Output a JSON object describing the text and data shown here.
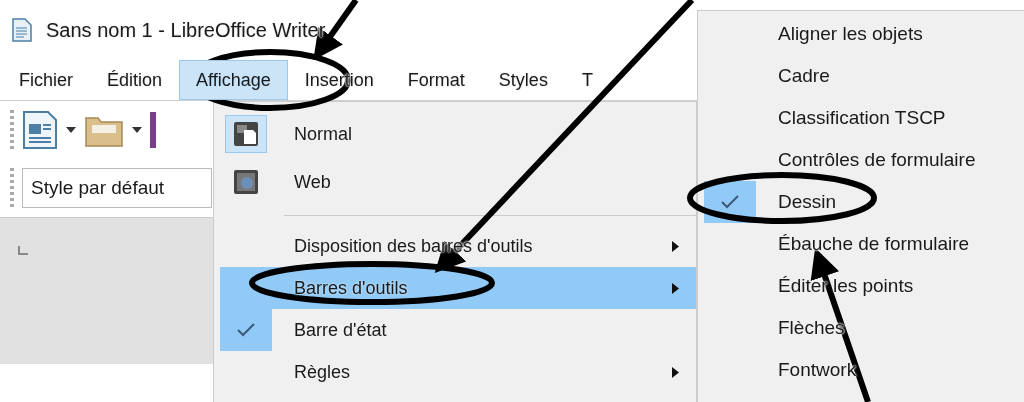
{
  "window": {
    "title": "Sans nom 1 - LibreOffice Writer"
  },
  "menubar": [
    {
      "label": "Fichier",
      "selected": false
    },
    {
      "label": "Édition",
      "selected": false
    },
    {
      "label": "Affichage",
      "selected": true
    },
    {
      "label": "Insertion",
      "selected": false
    },
    {
      "label": "Format",
      "selected": false
    },
    {
      "label": "Styles",
      "selected": false
    },
    {
      "label": "T",
      "selected": false
    }
  ],
  "toolbar": {
    "paragraph_style": "Style par défaut"
  },
  "view_menu": [
    {
      "kind": "icon",
      "label": "Normal",
      "checked": true,
      "selected": false,
      "submenu": false
    },
    {
      "kind": "icon",
      "label": "Web",
      "checked": false,
      "selected": false,
      "submenu": false
    },
    {
      "kind": "separator"
    },
    {
      "kind": "item",
      "label": "Disposition des barres d'outils",
      "checked": false,
      "selected": false,
      "submenu": true
    },
    {
      "kind": "item",
      "label": "Barres d'outils",
      "checked": false,
      "selected": true,
      "submenu": true
    },
    {
      "kind": "item",
      "label": "Barre d'état",
      "checked": true,
      "selected": false,
      "submenu": false
    },
    {
      "kind": "item",
      "label": "Règles",
      "checked": false,
      "selected": false,
      "submenu": true
    }
  ],
  "toolbars_submenu": [
    {
      "label": "Aligner les objets",
      "checked": false
    },
    {
      "label": "Cadre",
      "checked": false
    },
    {
      "label": "Classification TSCP",
      "checked": false
    },
    {
      "label": "Contrôles de formulaire",
      "checked": false
    },
    {
      "label": "Dessin",
      "checked": true
    },
    {
      "label": "Ébauche de formulaire",
      "checked": false
    },
    {
      "label": "Éditer les points",
      "checked": false
    },
    {
      "label": "Flèches",
      "checked": false
    },
    {
      "label": "Fontwork",
      "checked": false
    }
  ],
  "annotations": [
    {
      "kind": "ellipse"
    },
    {
      "kind": "ellipse"
    },
    {
      "kind": "ellipse"
    },
    {
      "kind": "arrow"
    },
    {
      "kind": "arrow"
    },
    {
      "kind": "arrow"
    }
  ]
}
